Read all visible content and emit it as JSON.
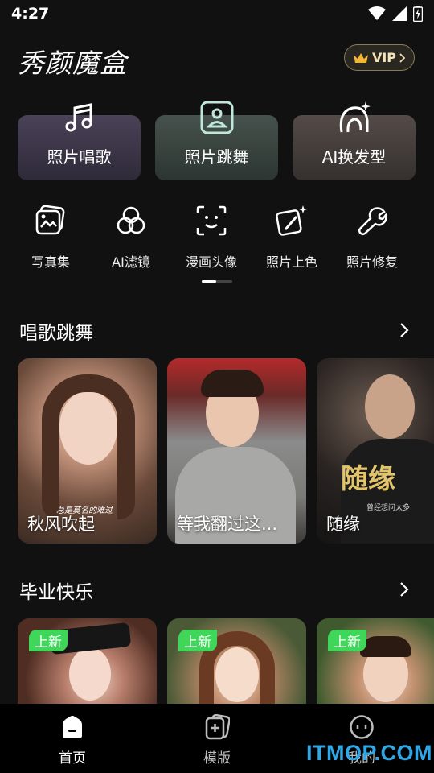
{
  "status_bar": {
    "time": "4:27"
  },
  "header": {
    "logo": "秀颜魔盒",
    "vip_label": "VIP"
  },
  "features": [
    {
      "label": "照片唱歌",
      "icon": "music-note-icon"
    },
    {
      "label": "照片跳舞",
      "icon": "portrait-frame-icon"
    },
    {
      "label": "AI换发型",
      "icon": "hair-sparkle-icon"
    }
  ],
  "tools": [
    {
      "label": "写真集",
      "icon": "photo-album-icon"
    },
    {
      "label": "AI滤镜",
      "icon": "filter-circles-icon"
    },
    {
      "label": "漫画头像",
      "icon": "face-scan-icon"
    },
    {
      "label": "照片上色",
      "icon": "colorize-icon"
    },
    {
      "label": "照片修复",
      "icon": "wrench-icon"
    }
  ],
  "sections": {
    "sing_dance": {
      "title": "唱歌跳舞",
      "cards": [
        {
          "caption": "秋风吹起",
          "overlay_text": "总是莫名的难过"
        },
        {
          "caption": "等我翻过这..."
        },
        {
          "caption": "随缘",
          "overlay_title": "随缘",
          "overlay_sub": "曾经想问太多"
        }
      ]
    },
    "graduation": {
      "title": "毕业快乐",
      "cards": [
        {
          "badge": "上新"
        },
        {
          "badge": "上新"
        },
        {
          "badge": "上新"
        }
      ]
    }
  },
  "bottom_nav": [
    {
      "label": "首页",
      "icon": "home-icon",
      "active": true
    },
    {
      "label": "模版",
      "icon": "template-icon",
      "active": false
    },
    {
      "label": "我的",
      "icon": "profile-icon",
      "active": false
    }
  ],
  "watermark": "ITMOP.COM",
  "colors": {
    "background": "#111111",
    "accent_green": "#3fd65a",
    "vip_gold": "#f3e3b6",
    "watermark_blue": "#2ea8e6"
  }
}
